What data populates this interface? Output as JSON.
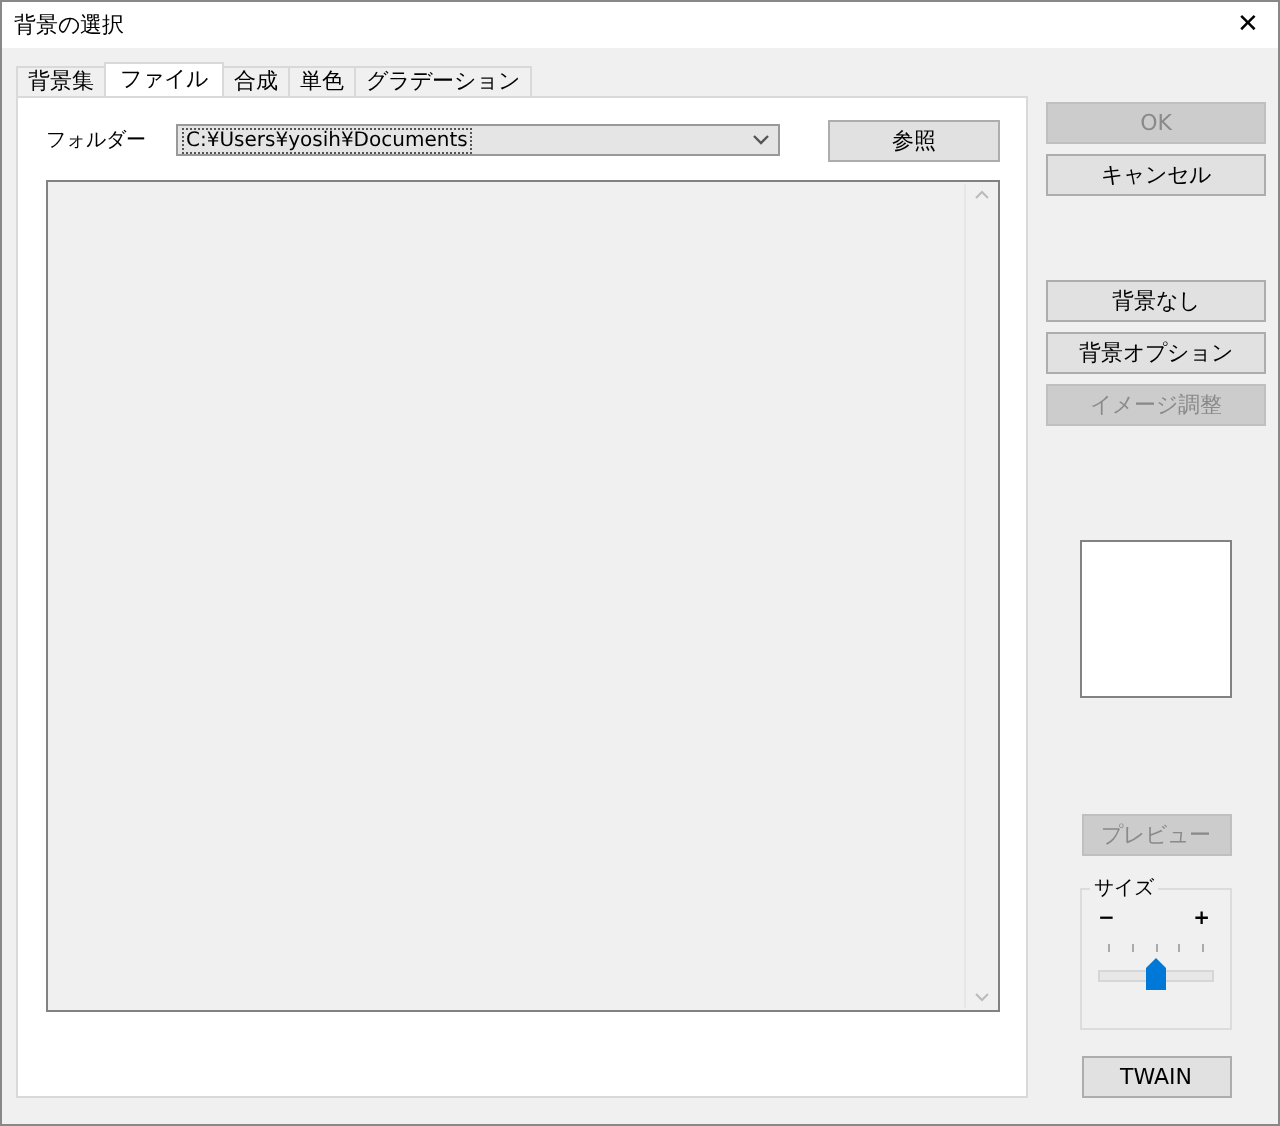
{
  "window": {
    "title": "背景の選択",
    "close": "✕"
  },
  "tabs": [
    {
      "label": "背景集",
      "selected": false
    },
    {
      "label": "ファイル",
      "selected": true
    },
    {
      "label": "合成",
      "selected": false
    },
    {
      "label": "単色",
      "selected": false
    },
    {
      "label": "グラデーション",
      "selected": false
    }
  ],
  "folder": {
    "label": "フォルダー",
    "value": "C:¥Users¥yosih¥Documents",
    "browse_button": "参照"
  },
  "side_buttons_top": [
    {
      "label": "OK",
      "disabled": true
    },
    {
      "label": "キャンセル",
      "disabled": false
    }
  ],
  "side_buttons_middle": [
    {
      "label": "背景なし",
      "disabled": false
    },
    {
      "label": "背景オプション",
      "disabled": false
    },
    {
      "label": "イメージ調整",
      "disabled": true
    }
  ],
  "preview_button": {
    "label": "プレビュー",
    "disabled": true
  },
  "size": {
    "title": "サイズ",
    "minus": "−",
    "plus": "+",
    "level": 0.5
  },
  "twain_button": {
    "label": "TWAIN",
    "disabled": false
  }
}
